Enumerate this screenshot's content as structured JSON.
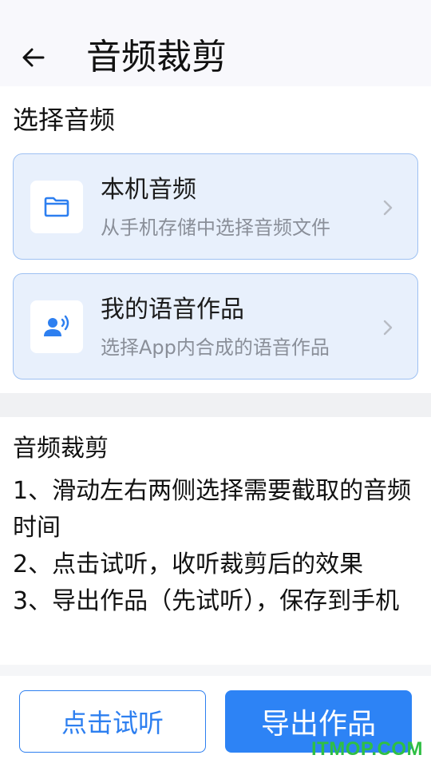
{
  "header": {
    "title": "音频裁剪",
    "back_icon": "arrow-left-icon"
  },
  "select": {
    "title": "选择音频",
    "cards": [
      {
        "title": "本机音频",
        "subtitle": "从手机存储中选择音频文件",
        "icon": "folder-icon"
      },
      {
        "title": "我的语音作品",
        "subtitle": "选择App内合成的语音作品",
        "icon": "voice-user-icon"
      }
    ]
  },
  "instructions": {
    "title": "音频裁剪",
    "lines": [
      "1、滑动左右两侧选择需要截取的音频时间",
      "2、点击试听，收听裁剪后的效果",
      "3、导出作品（先试听），保存到手机"
    ]
  },
  "actions": {
    "preview_label": "点击试听",
    "export_label": "导出作品"
  },
  "watermark": "ITMOP.COM",
  "colors": {
    "accent": "#2d83f5",
    "card_bg": "#e8f0fc",
    "card_border": "#9ec1f2",
    "watermark": "#2fbf44"
  }
}
